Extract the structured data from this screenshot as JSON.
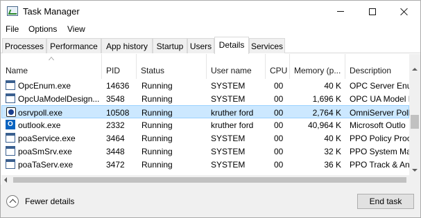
{
  "window": {
    "title": "Task Manager"
  },
  "menu": [
    "File",
    "Options",
    "View"
  ],
  "tabs": [
    "Processes",
    "Performance",
    "App history",
    "Startup",
    "Users",
    "Details",
    "Services"
  ],
  "active_tab": "Details",
  "columns": [
    "Name",
    "PID",
    "Status",
    "User name",
    "CPU",
    "Memory (p...",
    "Description"
  ],
  "rows": [
    {
      "name": "OpcEnum.exe",
      "pid": "14636",
      "status": "Running",
      "user": "SYSTEM",
      "cpu": "00",
      "memory": "40 K",
      "description": "OPC Server Enum",
      "icon": "app-window-icon"
    },
    {
      "name": "OpcUaModelDesign...",
      "pid": "3548",
      "status": "Running",
      "user": "SYSTEM",
      "cpu": "00",
      "memory": "1,696 K",
      "description": "OPC UA Model D",
      "icon": "app-window-icon"
    },
    {
      "name": "osrvpoll.exe",
      "pid": "10508",
      "status": "Running",
      "user": "kruther ford",
      "cpu": "00",
      "memory": "2,764 K",
      "description": "OmniServer Poll",
      "icon": "omniserver-icon",
      "selected": true
    },
    {
      "name": "outlook.exe",
      "pid": "2332",
      "status": "Running",
      "user": "kruther ford",
      "cpu": "00",
      "memory": "40,964 K",
      "description": "Microsoft Outlo",
      "icon": "outlook-icon"
    },
    {
      "name": "poaService.exe",
      "pid": "3464",
      "status": "Running",
      "user": "SYSTEM",
      "cpu": "00",
      "memory": "40 K",
      "description": "PPO Policy Proc",
      "icon": "app-window-icon"
    },
    {
      "name": "poaSmSrv.exe",
      "pid": "3448",
      "status": "Running",
      "user": "SYSTEM",
      "cpu": "00",
      "memory": "32 K",
      "description": "PPO System Ma",
      "icon": "app-window-icon"
    },
    {
      "name": "poaTaServ.exe",
      "pid": "3472",
      "status": "Running",
      "user": "SYSTEM",
      "cpu": "00",
      "memory": "36 K",
      "description": "PPO Track & An",
      "icon": "app-window-icon"
    }
  ],
  "footer": {
    "fewer_details": "Fewer details",
    "end_task": "End task"
  },
  "colors": {
    "selection_bg": "#cce8ff",
    "selection_border": "#99d1ff",
    "footer_bg": "#f0f0f0"
  }
}
